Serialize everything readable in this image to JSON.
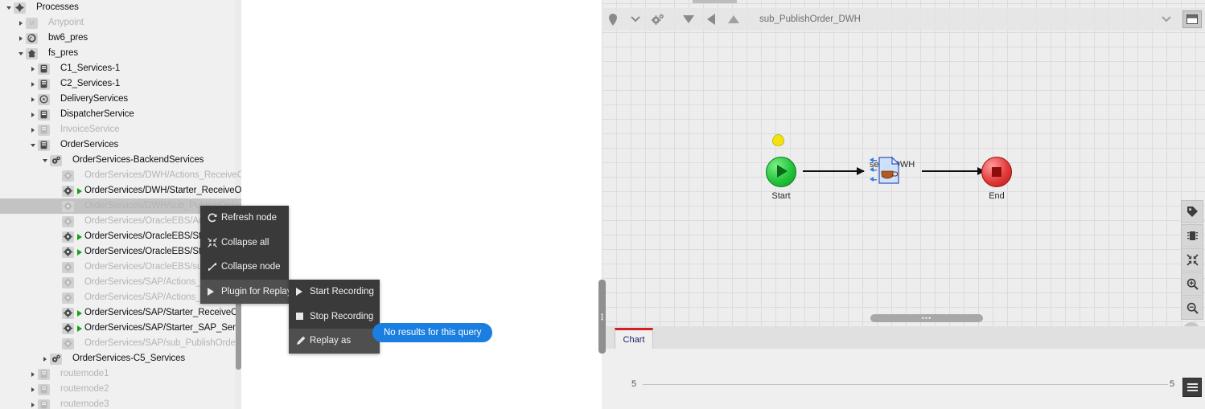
{
  "tree": {
    "items": [
      {
        "label": "Processes",
        "icon": "diamond-icon",
        "depth": 0,
        "twisty": "open",
        "dim": false,
        "running": false,
        "selected": false
      },
      {
        "label": "Anypoint",
        "icon": "anypoint-icon",
        "depth": 1,
        "twisty": "closed",
        "dim": true,
        "running": false,
        "selected": false
      },
      {
        "label": "bw6_pres",
        "icon": "spiral-icon",
        "depth": 1,
        "twisty": "closed",
        "dim": false,
        "running": false,
        "selected": false
      },
      {
        "label": "fs_pres",
        "icon": "home-icon",
        "depth": 1,
        "twisty": "open",
        "dim": false,
        "running": false,
        "selected": false
      },
      {
        "label": "C1_Services-1",
        "icon": "server-icon",
        "depth": 2,
        "twisty": "closed",
        "dim": false,
        "running": false,
        "selected": false
      },
      {
        "label": "C2_Services-1",
        "icon": "server-icon",
        "depth": 2,
        "twisty": "closed",
        "dim": false,
        "running": false,
        "selected": false
      },
      {
        "label": "DeliveryServices",
        "icon": "circle-icon",
        "depth": 2,
        "twisty": "closed",
        "dim": false,
        "running": false,
        "selected": false
      },
      {
        "label": "DispatcherService",
        "icon": "server-icon",
        "depth": 2,
        "twisty": "closed",
        "dim": false,
        "running": false,
        "selected": false
      },
      {
        "label": "InvoiceService",
        "icon": "server-icon",
        "depth": 2,
        "twisty": "closed",
        "dim": true,
        "running": false,
        "selected": false
      },
      {
        "label": "OrderServices",
        "icon": "server-icon",
        "depth": 2,
        "twisty": "open",
        "dim": false,
        "running": false,
        "selected": false
      },
      {
        "label": "OrderServices-BackendServices",
        "icon": "gears-icon",
        "depth": 3,
        "twisty": "open",
        "dim": false,
        "running": false,
        "selected": false
      },
      {
        "label": "OrderServices/DWH/Actions_ReceiveOrd",
        "icon": "gear-icon",
        "depth": 4,
        "twisty": "none",
        "dim": true,
        "running": false,
        "selected": false
      },
      {
        "label": "OrderServices/DWH/Starter_ReceiveOrd",
        "icon": "gear-icon",
        "depth": 4,
        "twisty": "none",
        "dim": false,
        "running": true,
        "selected": false
      },
      {
        "label": "OrderServices/DWH/sub_PublishOrder_",
        "icon": "gear-icon",
        "depth": 4,
        "twisty": "none",
        "dim": true,
        "running": false,
        "selected": true
      },
      {
        "label": "OrderServices/OracleEBS/Actions_",
        "icon": "gear-icon",
        "depth": 4,
        "twisty": "none",
        "dim": true,
        "running": false,
        "selected": false
      },
      {
        "label": "OrderServices/OracleEBS/Starter_",
        "icon": "gear-icon",
        "depth": 4,
        "twisty": "none",
        "dim": false,
        "running": true,
        "selected": false
      },
      {
        "label": "OrderServices/OracleEBS/Starter_",
        "icon": "gear-icon",
        "depth": 4,
        "twisty": "none",
        "dim": false,
        "running": true,
        "selected": false
      },
      {
        "label": "OrderServices/OracleEBS/sub_",
        "icon": "gear-icon",
        "depth": 4,
        "twisty": "none",
        "dim": true,
        "running": false,
        "selected": false
      },
      {
        "label": "OrderServices/SAP/Actions_",
        "icon": "gear-icon",
        "depth": 4,
        "twisty": "none",
        "dim": true,
        "running": false,
        "selected": false
      },
      {
        "label": "OrderServices/SAP/Actions_",
        "icon": "gear-icon",
        "depth": 4,
        "twisty": "none",
        "dim": true,
        "running": false,
        "selected": false
      },
      {
        "label": "OrderServices/SAP/Starter_ReceiveOrd",
        "icon": "gear-icon",
        "depth": 4,
        "twisty": "none",
        "dim": false,
        "running": true,
        "selected": false
      },
      {
        "label": "OrderServices/SAP/Starter_SAP_SendO",
        "icon": "gear-icon",
        "depth": 4,
        "twisty": "none",
        "dim": false,
        "running": true,
        "selected": false
      },
      {
        "label": "OrderServices/SAP/sub_PublishOrder_S",
        "icon": "gear-icon",
        "depth": 4,
        "twisty": "none",
        "dim": true,
        "running": false,
        "selected": false
      },
      {
        "label": "OrderServices-C5_Services",
        "icon": "gears-icon",
        "depth": 3,
        "twisty": "closed",
        "dim": false,
        "running": false,
        "selected": false
      },
      {
        "label": "routemode1",
        "icon": "server-icon",
        "depth": 2,
        "twisty": "closed",
        "dim": true,
        "running": false,
        "selected": false
      },
      {
        "label": "routemode2",
        "icon": "server-icon",
        "depth": 2,
        "twisty": "closed",
        "dim": true,
        "running": false,
        "selected": false
      },
      {
        "label": "routemode3",
        "icon": "server-icon",
        "depth": 2,
        "twisty": "closed",
        "dim": true,
        "running": false,
        "selected": false
      }
    ]
  },
  "context_menu": {
    "items": [
      {
        "label": "Refresh node",
        "icon": "refresh-icon",
        "active": false
      },
      {
        "label": "Collapse all",
        "icon": "collapse-all-icon",
        "active": false
      },
      {
        "label": "Collapse node",
        "icon": "collapse-node-icon",
        "active": false
      },
      {
        "label": "Plugin for Replay",
        "icon": "play-triangle-icon",
        "active": true
      }
    ],
    "submenu": {
      "items": [
        {
          "label": "Start Recording",
          "icon": "play-triangle-icon",
          "active": false
        },
        {
          "label": "Stop Recording",
          "icon": "stop-square-icon",
          "active": false
        },
        {
          "label": "Replay as",
          "icon": "pencil-icon",
          "active": true
        }
      ]
    }
  },
  "tooltip": {
    "text": "No results for this query"
  },
  "canvas": {
    "toolbar": {
      "title": "sub_PublishOrder_DWH",
      "buttons": [
        {
          "icon": "location-pin-icon"
        },
        {
          "icon": "chevron-down-icon"
        },
        {
          "icon": "gears-icon"
        },
        {
          "icon": "triangle-down-icon"
        },
        {
          "icon": "triangle-left-icon"
        },
        {
          "icon": "triangle-up-icon"
        }
      ],
      "right_buttons": [
        {
          "icon": "chevron-down-icon"
        },
        {
          "icon": "restore-window-icon"
        }
      ]
    },
    "diagram": {
      "nodes": [
        {
          "name": "Start",
          "type": "start-event"
        },
        {
          "name": "send_DWH",
          "type": "java-task"
        },
        {
          "name": "End",
          "type": "end-event"
        }
      ]
    },
    "side_tools": [
      {
        "icon": "tag-icon"
      },
      {
        "icon": "chip-icon"
      },
      {
        "icon": "collapse-icon"
      },
      {
        "icon": "zoom-in-icon"
      },
      {
        "icon": "zoom-out-icon"
      }
    ],
    "download_button": {
      "icon": "download-circle-icon"
    }
  },
  "chart_panel": {
    "tab_label": "Chart",
    "menu_button_icon": "list-menu-icon"
  },
  "chart_data": {
    "type": "line",
    "title": "",
    "xlabel": "",
    "ylabel": "",
    "y_tick_left": "5",
    "y_tick_right": "5",
    "categories": [],
    "values": [],
    "ylim": [
      5,
      5
    ],
    "grid": false,
    "legend": "none"
  },
  "colors": {
    "accent_red": "#cf2026",
    "tooltip_blue": "#1a7fe0",
    "start_green": "#24c43c",
    "end_red": "#e33b3b",
    "marker_yellow": "#f2e310",
    "menu_dark": "#3a3a3a"
  }
}
